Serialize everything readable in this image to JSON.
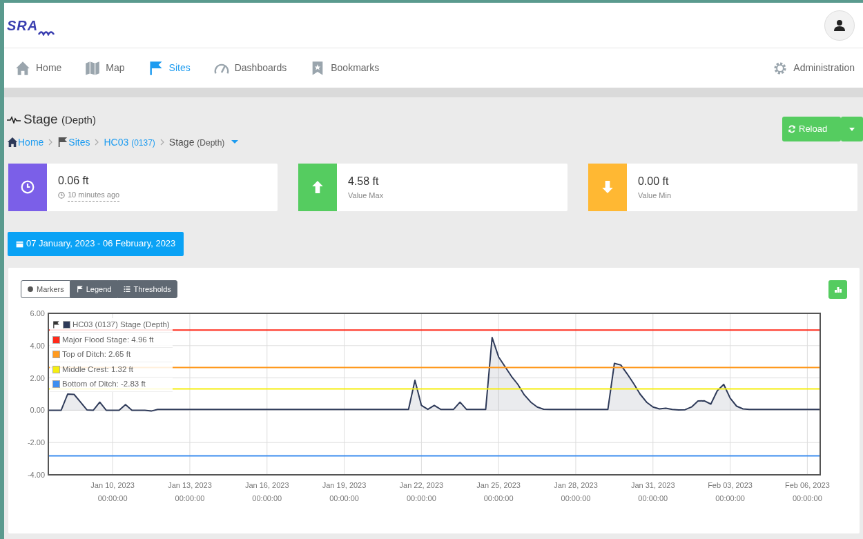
{
  "logo": {
    "text": "SRA"
  },
  "nav": [
    {
      "label": "Home",
      "selected": false
    },
    {
      "label": "Map",
      "selected": false
    },
    {
      "label": "Sites",
      "selected": true
    },
    {
      "label": "Dashboards",
      "selected": false
    },
    {
      "label": "Bookmarks",
      "selected": false
    }
  ],
  "admin": {
    "label": "Administration"
  },
  "page_title": {
    "text": "Stage",
    "sub": "(Depth)"
  },
  "breadcrumb": [
    {
      "label": "Home",
      "kind": "link"
    },
    {
      "label": "Sites",
      "kind": "link"
    },
    {
      "label": "HC03",
      "sub": "(0137)",
      "kind": "link"
    },
    {
      "label": "Stage",
      "sub": "(Depth)",
      "kind": "current"
    }
  ],
  "reload_button": {
    "label": "Reload"
  },
  "stats": [
    {
      "value": "0.06 ft",
      "caption": "10 minutes ago",
      "kind": "clock",
      "color": "#7b5fe8"
    },
    {
      "value": "4.58 ft",
      "caption": "Value Max",
      "kind": "up",
      "color": "#55cc60"
    },
    {
      "value": "0.00 ft",
      "caption": "Value Min",
      "kind": "down",
      "color": "#ffb833"
    }
  ],
  "date_range": {
    "label": "07 January, 2023 - 06 February, 2023"
  },
  "toggles": [
    {
      "label": "Markers",
      "on": false
    },
    {
      "label": "Legend",
      "on": true
    },
    {
      "label": "Thresholds",
      "on": true
    }
  ],
  "chart": {
    "chart_data": {
      "type": "area",
      "grid": true,
      "legend": "upper left",
      "categories": [
        null,
        null,
        null,
        null,
        null,
        null,
        null,
        null,
        null,
        null,
        "Jan 10, 2023 00:00:00",
        null,
        null,
        null,
        null,
        null,
        null,
        null,
        null,
        null,
        null,
        null,
        "Jan 13, 2023 00:00:00",
        null,
        null,
        null,
        null,
        null,
        null,
        null,
        null,
        null,
        null,
        null,
        "Jan 16, 2023 00:00:00",
        null,
        null,
        null,
        null,
        null,
        null,
        null,
        null,
        null,
        null,
        null,
        "Jan 19, 2023 00:00:00",
        null,
        null,
        null,
        null,
        null,
        null,
        null,
        null,
        null,
        null,
        null,
        "Jan 22, 2023 00:00:00",
        null,
        null,
        null,
        null,
        null,
        null,
        null,
        null,
        null,
        null,
        null,
        "Jan 25, 2023 00:00:00",
        null,
        null,
        null,
        null,
        null,
        null,
        null,
        null,
        null,
        null,
        null,
        "Jan 28, 2023 00:00:00",
        null,
        null,
        null,
        null,
        null,
        null,
        null,
        null,
        null,
        null,
        null,
        "Jan 31, 2023 00:00:00",
        null,
        null,
        null,
        null,
        null,
        null,
        null,
        null,
        null,
        null,
        null,
        "Feb 03, 2023 00:00:00",
        null,
        null,
        null,
        null,
        null,
        null,
        null,
        null,
        null,
        null,
        null,
        "Feb 06, 2023 00:00:00",
        null,
        null
      ],
      "series": [
        {
          "name": "HC03 (0137) Stage (Depth)",
          "color": "#2e3a59",
          "values": [
            0,
            0,
            0,
            1.0,
            0.98,
            0.5,
            0.02,
            0,
            0.5,
            0,
            0,
            0,
            0.35,
            0,
            0,
            0,
            -0.05,
            0.05,
            0.05,
            0.05,
            0.05,
            0.05,
            0.05,
            0.05,
            0.05,
            0.05,
            0.05,
            0.05,
            0.05,
            0.05,
            0.05,
            0.05,
            0.05,
            0.05,
            0.05,
            0.05,
            0.05,
            0.05,
            0.05,
            0.05,
            0.05,
            0.05,
            0.05,
            0.05,
            0.05,
            0.05,
            0.05,
            0.05,
            0.05,
            0.05,
            0.05,
            0.05,
            0.05,
            0.05,
            0.05,
            0.05,
            0.05,
            1.85,
            0.3,
            0.05,
            0.3,
            0.05,
            0.05,
            0.05,
            0.5,
            0.05,
            0.05,
            0.05,
            0.05,
            4.5,
            3.3,
            2.7,
            2.1,
            1.6,
            0.95,
            0.5,
            0.2,
            0.06,
            0.05,
            0.05,
            0.05,
            0.05,
            0.05,
            0.05,
            0.05,
            0.05,
            0.05,
            0.05,
            2.9,
            2.8,
            2.25,
            1.65,
            1.0,
            0.5,
            0.2,
            0.08,
            0.12,
            0.05,
            0.02,
            0.03,
            0.2,
            0.57,
            0.58,
            0.38,
            1.2,
            1.6,
            0.75,
            0.25,
            0.08,
            0.05,
            0.05,
            0.05,
            0.05,
            0.05,
            0.05,
            0.05,
            0.05,
            0.05,
            0.05,
            0.05,
            0.05
          ]
        }
      ],
      "ylim": [
        -4,
        6
      ],
      "yticks": [
        {
          "value": 6,
          "label": "6.00"
        },
        {
          "value": 4,
          "label": "4.00"
        },
        {
          "value": 2,
          "label": "2.00"
        },
        {
          "value": 0,
          "label": "0.00"
        },
        {
          "value": -2,
          "label": "-2.00"
        },
        {
          "value": -4,
          "label": "-4.00"
        }
      ],
      "ref_lines": [
        {
          "axis": "y",
          "value": 4.96,
          "label": "Major Flood Stage: 4.96 ft",
          "color": "#ff2a1a"
        },
        {
          "axis": "y",
          "value": 2.65,
          "label": "Top of Ditch: 2.65 ft",
          "color": "#ff9a1f"
        },
        {
          "axis": "y",
          "value": 1.32,
          "label": "Middle Crest: 1.32 ft",
          "color": "#f5ee10"
        },
        {
          "axis": "y",
          "value": -2.83,
          "label": "Bottom of Ditch: -2.83 ft",
          "color": "#3d8ef0"
        }
      ]
    }
  }
}
